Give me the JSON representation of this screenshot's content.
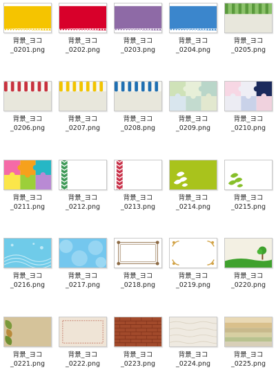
{
  "files": [
    {
      "name": "背景_ヨコ",
      "ext": "_0201.png",
      "thumb": "ribbon-yellow-thumbnail"
    },
    {
      "name": "背景_ヨコ",
      "ext": "_0202.png",
      "thumb": "ribbon-red-thumbnail"
    },
    {
      "name": "背景_ヨコ",
      "ext": "_0203.png",
      "thumb": "ribbon-purple-thumbnail"
    },
    {
      "name": "背景_ヨコ",
      "ext": "_0204.png",
      "thumb": "ribbon-blue-thumbnail"
    },
    {
      "name": "背景_ヨコ",
      "ext": "_0205.png",
      "thumb": "green-awning-thumbnail"
    },
    {
      "name": "背景_ヨコ",
      "ext": "_0206.png",
      "thumb": "red-awning-thumbnail"
    },
    {
      "name": "背景_ヨコ",
      "ext": "_0207.png",
      "thumb": "yellow-awning-thumbnail"
    },
    {
      "name": "背景_ヨコ",
      "ext": "_0208.png",
      "thumb": "blue-awning-thumbnail"
    },
    {
      "name": "背景_ヨコ",
      "ext": "_0209.png",
      "thumb": "green-puzzle-thumbnail"
    },
    {
      "name": "背景_ヨコ",
      "ext": "_0210.png",
      "thumb": "pink-navy-puzzle-thumbnail"
    },
    {
      "name": "背景_ヨコ",
      "ext": "_0211.png",
      "thumb": "colorful-puzzle-thumbnail"
    },
    {
      "name": "背景_ヨコ",
      "ext": "_0212.png",
      "thumb": "green-zigzag-border-thumbnail"
    },
    {
      "name": "背景_ヨコ",
      "ext": "_0213.png",
      "thumb": "red-zigzag-border-thumbnail"
    },
    {
      "name": "背景_ヨコ",
      "ext": "_0214.png",
      "thumb": "green-leaves-thumbnail"
    },
    {
      "name": "背景_ヨコ",
      "ext": "_0215.png",
      "thumb": "white-leaves-thumbnail"
    },
    {
      "name": "背景_ヨコ",
      "ext": "_0216.png",
      "thumb": "blue-waves-thumbnail"
    },
    {
      "name": "背景_ヨコ",
      "ext": "_0217.png",
      "thumb": "blue-bubbles-thumbnail"
    },
    {
      "name": "背景_ヨコ",
      "ext": "_0218.png",
      "thumb": "brown-ornate-frame-thumbnail"
    },
    {
      "name": "背景_ヨコ",
      "ext": "_0219.png",
      "thumb": "gold-ornate-frame-thumbnail"
    },
    {
      "name": "背景_ヨコ",
      "ext": "_0220.png",
      "thumb": "tree-landscape-thumbnail"
    },
    {
      "name": "背景_ヨコ",
      "ext": "_0221.png",
      "thumb": "kraft-leaves-thumbnail"
    },
    {
      "name": "背景_ヨコ",
      "ext": "_0222.png",
      "thumb": "stitched-frame-thumbnail"
    },
    {
      "name": "背景_ヨコ",
      "ext": "_0223.png",
      "thumb": "brick-wall-thumbnail"
    },
    {
      "name": "背景_ヨコ",
      "ext": "_0224.png",
      "thumb": "paper-texture-thumbnail"
    },
    {
      "name": "背景_ヨコ",
      "ext": "_0225.png",
      "thumb": "watercolor-stripes-thumbnail"
    }
  ],
  "colors": {
    "yellow": "#f5c400",
    "red": "#d8002a",
    "purple": "#8e6aa6",
    "blue": "#3b86cc",
    "green": "#5a9a3c",
    "cream": "#e8e7dc",
    "lime": "#a9c31c",
    "sky": "#6fcbe9",
    "kraft": "#d5c39a",
    "brick": "#a24a2b"
  }
}
